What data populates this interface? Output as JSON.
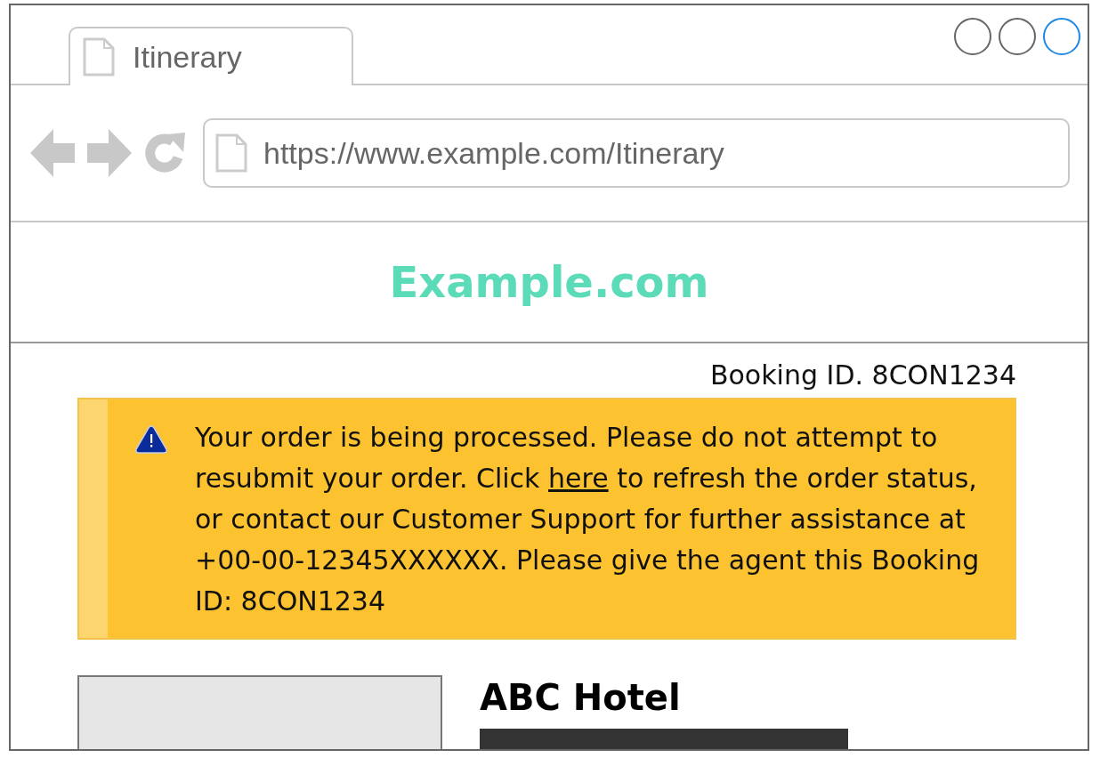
{
  "window": {
    "controls": [
      {
        "color": "#666666"
      },
      {
        "color": "#666666"
      },
      {
        "color": "#1e88e5"
      }
    ]
  },
  "tabs": [
    {
      "label": "Itinerary",
      "selected": true
    }
  ],
  "address_bar": {
    "value": "https://www.example.com/Itinerary"
  },
  "site": {
    "logo": "Example.com"
  },
  "booking_id": "Booking ID. 8CON1234",
  "alert": {
    "before": "Your order is being processed. Please do not attempt to resubmit your order. Click ",
    "link": "here",
    "after": " to refresh the order status, or contact our Customer Support for further assistance at +00-00-12345XXXXXX. Please give the agent this Booking ID: 8CON1234"
  },
  "hotel": {
    "name": "ABC Hotel"
  }
}
